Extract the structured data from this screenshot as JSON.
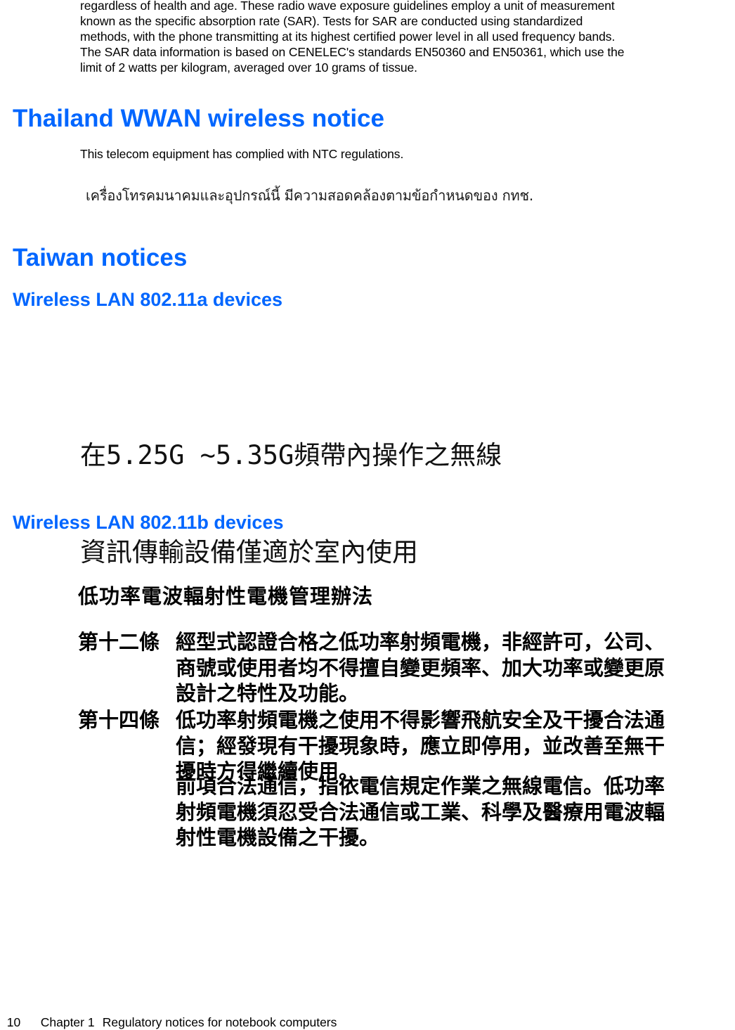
{
  "intro_paragraph": {
    "lines": [
      "regardless of health and age. These radio wave exposure guidelines employ a unit of measurement",
      "known as the specific absorption rate (SAR). Tests for SAR are conducted using standardized",
      "methods, with the phone transmitting at its highest certified power level in all used frequency bands.",
      "The SAR data information is based on CENELEC's standards EN50360 and EN50361, which use the",
      "limit of 2 watts per kilogram, averaged over 10 grams of tissue."
    ]
  },
  "thailand": {
    "heading": "Thailand WWAN wireless notice",
    "body": "This telecom equipment has complied with NTC regulations.",
    "thai_notice": "เครื่องโทรคมนาคมและอุปกรณ์นี้ มีความสอดคล้องตามข้อกำหนดของ กทช."
  },
  "taiwan": {
    "heading": "Taiwan notices",
    "wlan_a": {
      "heading": "Wireless LAN 802.11a devices",
      "notice_lines": [
        "在5.25G ~5.35G頻帶內操作之無線",
        "資訊傳輸設備僅適於室內使用"
      ]
    },
    "wlan_b": {
      "heading": "Wireless LAN 802.11b devices",
      "title": "低功率電波輻射性電機管理辦法",
      "article_12": {
        "label": "第十二條",
        "lines": [
          "經型式認證合格之低功率射頻電機，非經許可，公司、",
          "商號或使用者均不得擅自變更頻率、加大功率或變更原",
          "設計之特性及功能。"
        ]
      },
      "article_14": {
        "label": "第十四條",
        "lines": [
          "低功率射頻電機之使用不得影響飛航安全及干擾合法通",
          "信；經發現有干擾現象時，應立即停用，並改善至無干",
          "擾時方得繼續使用。"
        ],
        "continuation_lines": [
          "前項合法通信，指依電信規定作業之無線電信。低功率",
          "射頻電機須忍受合法通信或工業、科學及醫療用電波輻",
          "射性電機設備之干擾。"
        ]
      }
    }
  },
  "footer": {
    "page_number": "10",
    "chapter": "Chapter 1",
    "chapter_title": "Regulatory notices for notebook computers"
  },
  "colors": {
    "heading": "#0066ff",
    "text": "#000000",
    "background": "#ffffff"
  }
}
